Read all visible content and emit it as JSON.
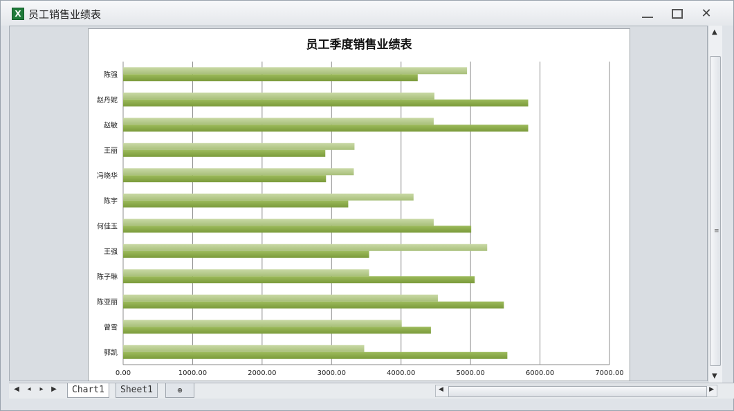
{
  "window": {
    "title": "员工销售业绩表",
    "minimize": "",
    "maximize": "",
    "close": "✕"
  },
  "chart_data": {
    "type": "bar",
    "orientation": "horizontal",
    "title": "员工季度销售业绩表",
    "categories": [
      "陈强",
      "赵丹妮",
      "赵敏",
      "王丽",
      "冯晓华",
      "陈宇",
      "何佳玉",
      "王强",
      "陈子琳",
      "陈亚丽",
      "曾雪",
      "郭凯"
    ],
    "series": [
      {
        "values": [
          4950,
          4480,
          4470,
          3330,
          3320,
          4180,
          4470,
          5240,
          3540,
          4530,
          4010,
          3470
        ],
        "color": "#a8bf7a"
      },
      {
        "values": [
          4240,
          5830,
          5830,
          2910,
          2920,
          3240,
          5010,
          3540,
          5060,
          5480,
          4430,
          5530
        ],
        "color": "#7a9a3a"
      }
    ],
    "xlim": [
      0,
      7000
    ],
    "xticks": [
      "0.00",
      "1000.00",
      "2000.00",
      "3000.00",
      "4000.00",
      "5000.00",
      "6000.00",
      "7000.00"
    ],
    "grid": true,
    "legend": "none"
  },
  "tabs": {
    "chart": "Chart1",
    "sheet": "Sheet1",
    "new": "⊕"
  },
  "nav": {
    "first": "◀",
    "prev": "◂",
    "next": "▸",
    "last": "▶"
  },
  "scroll": {
    "up": "▲",
    "down": "▼",
    "grip": "≡",
    "left": "◀",
    "right": "▶"
  }
}
